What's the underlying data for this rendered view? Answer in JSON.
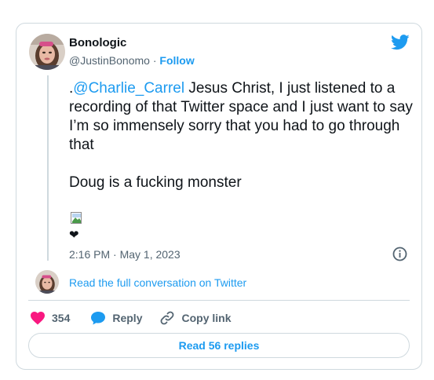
{
  "author": {
    "display_name": "Bonologic",
    "handle": "@JustinBonomo",
    "separator": "·",
    "follow_label": "Follow"
  },
  "tweet": {
    "mention": "@Charlie_Carrel",
    "leading_dot": ".",
    "text_after_mention": " Jesus Christ, I just listened to a recording of that Twitter space and I just want to say I’m so immensely sorry that you had to go through that",
    "second_paragraph": "Doug is a fucking monster",
    "emoji": "❤",
    "timestamp": "2:16 PM · May 1, 2023"
  },
  "conversation_link": "Read the full conversation on Twitter",
  "actions": {
    "like_count": "354",
    "reply_label": "Reply",
    "copy_link_label": "Copy link"
  },
  "replies_button": "Read 56 replies",
  "colors": {
    "accent": "#1d9bf0",
    "like": "#f91880",
    "secondary_text": "#536471",
    "border": "#cfd9de"
  },
  "icons": [
    "twitter-bird-icon",
    "info-icon",
    "heart-icon",
    "reply-bubble-icon",
    "link-icon",
    "broken-image-icon"
  ]
}
